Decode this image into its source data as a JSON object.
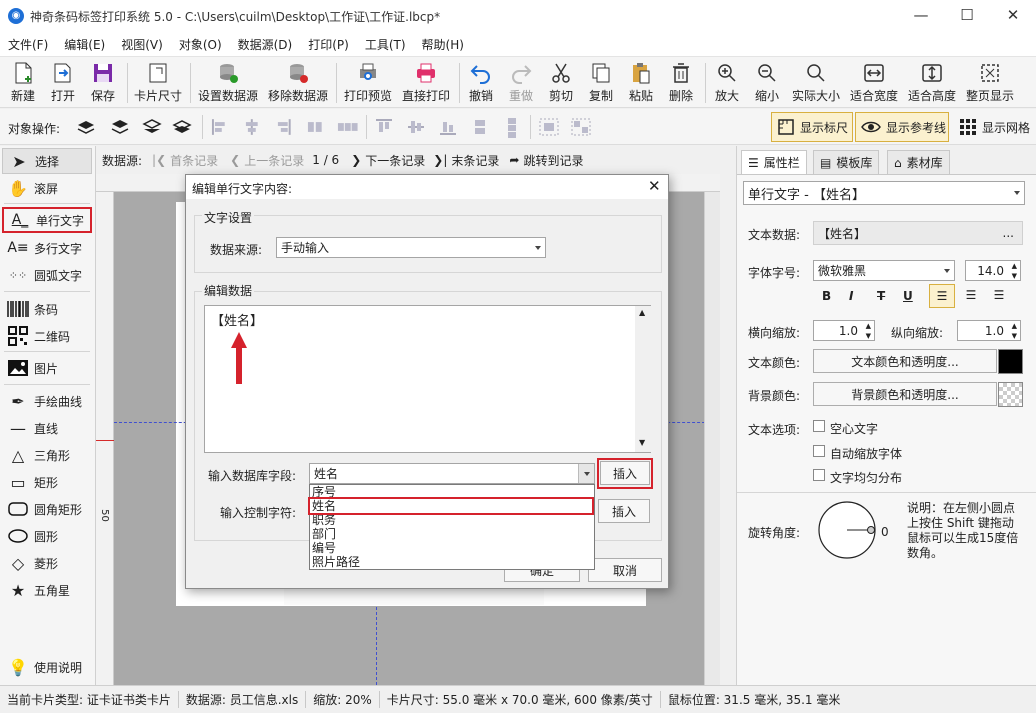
{
  "window": {
    "title": "神奇条码标签打印系统 5.0 - C:\\Users\\cuilm\\Desktop\\工作证\\工作证.lbcp*",
    "app_icon": "app-logo-icon"
  },
  "menu": [
    "文件(F)",
    "编辑(E)",
    "视图(V)",
    "对象(O)",
    "数据源(D)",
    "打印(P)",
    "工具(T)",
    "帮助(H)"
  ],
  "toolbar": {
    "new": "新建",
    "open": "打开",
    "save": "保存",
    "card_size": "卡片尺寸",
    "set_datasource": "设置数据源",
    "remove_datasource": "移除数据源",
    "print_preview": "打印预览",
    "direct_print": "直接打印",
    "undo": "撤销",
    "redo": "重做",
    "cut": "剪切",
    "copy": "复制",
    "paste": "粘贴",
    "delete": "删除",
    "zoom_in": "放大",
    "zoom_out": "缩小",
    "actual_size": "实际大小",
    "fit_width": "适合宽度",
    "fit_height": "适合高度",
    "full_page": "整页显示"
  },
  "toolbar2": {
    "object_ops_label": "对象操作:",
    "show_ruler": "显示标尺",
    "show_guides": "显示参考线",
    "show_grid": "显示网格"
  },
  "left_tools": [
    {
      "label": "选择",
      "icon": "arrow-cursor-icon"
    },
    {
      "label": "滚屏",
      "icon": "hand-icon"
    },
    {
      "label": "单行文字",
      "icon": "single-line-text-icon"
    },
    {
      "label": "多行文字",
      "icon": "multi-line-text-icon"
    },
    {
      "label": "圆弧文字",
      "icon": "arc-text-icon"
    },
    {
      "label": "条码",
      "icon": "barcode-icon"
    },
    {
      "label": "二维码",
      "icon": "qrcode-icon"
    },
    {
      "label": "图片",
      "icon": "picture-icon"
    },
    {
      "label": "手绘曲线",
      "icon": "pen-icon"
    },
    {
      "label": "直线",
      "icon": "line-icon"
    },
    {
      "label": "三角形",
      "icon": "triangle-icon"
    },
    {
      "label": "矩形",
      "icon": "rectangle-icon"
    },
    {
      "label": "圆角矩形",
      "icon": "rounded-rectangle-icon"
    },
    {
      "label": "圆形",
      "icon": "circle-icon"
    },
    {
      "label": "菱形",
      "icon": "diamond-icon"
    },
    {
      "label": "五角星",
      "icon": "star-icon"
    },
    {
      "label": "使用说明",
      "icon": "lightbulb-icon"
    }
  ],
  "record_nav": {
    "datasource_label": "数据源:",
    "first": "首条记录",
    "prev": "上一条记录",
    "position": "1 / 6",
    "next": "下一条记录",
    "last": "末条记录",
    "goto": "跳转到记录"
  },
  "right_panel": {
    "tabs": [
      "属性栏",
      "模板库",
      "素材库"
    ],
    "object_select": "单行文字 - 【姓名】",
    "text_data_label": "文本数据:",
    "text_data_value": "【姓名】",
    "text_data_more": "...",
    "font_label": "字体字号:",
    "font_value": "微软雅黑",
    "font_size": "14.0",
    "bold": "B",
    "italic": "I",
    "strike": "T",
    "underline": "U",
    "hscale_label": "横向缩放:",
    "hscale": "1.0",
    "vscale_label": "纵向缩放:",
    "vscale": "1.0",
    "text_color_label": "文本颜色:",
    "text_color_button": "文本颜色和透明度...",
    "bg_color_label": "背景颜色:",
    "bg_color_button": "背景颜色和透明度...",
    "text_options_label": "文本选项:",
    "opt_hollow": "空心文字",
    "opt_autoscale": "自动缩放字体",
    "opt_justify": "文字均匀分布",
    "rotation_label": "旋转角度:",
    "rotation_value": "0",
    "rotation_help": "说明：在左侧小圆点上按住 Shift 键拖动鼠标可以生成15度倍数角。",
    "text_color_hex": "#000000"
  },
  "dialog": {
    "title": "编辑单行文字内容:",
    "text_settings_group": "文字设置",
    "source_label": "数据来源:",
    "source_value": "手动输入",
    "edit_data_group": "编辑数据",
    "edit_text": "【姓名】",
    "db_field_label": "输入数据库字段:",
    "db_field_value": "姓名",
    "insert": "插入",
    "control_char_label": "输入控制字符:",
    "insert2": "插入",
    "ok": "确定",
    "cancel": "取消",
    "field_options": [
      "序号",
      "姓名",
      "职务",
      "部门",
      "编号",
      "照片路径"
    ],
    "selected_option": "姓名"
  },
  "ruler_mark": "50",
  "status": {
    "card_type": "当前卡片类型: 证卡证书类卡片",
    "datasource": "数据源: 员工信息.xls",
    "zoom": "缩放: 20%",
    "card_size": "卡片尺寸: 55.0 毫米 x 70.0 毫米, 600 像素/英寸",
    "coords": "鼠标位置: 31.5 毫米, 35.1 毫米"
  }
}
